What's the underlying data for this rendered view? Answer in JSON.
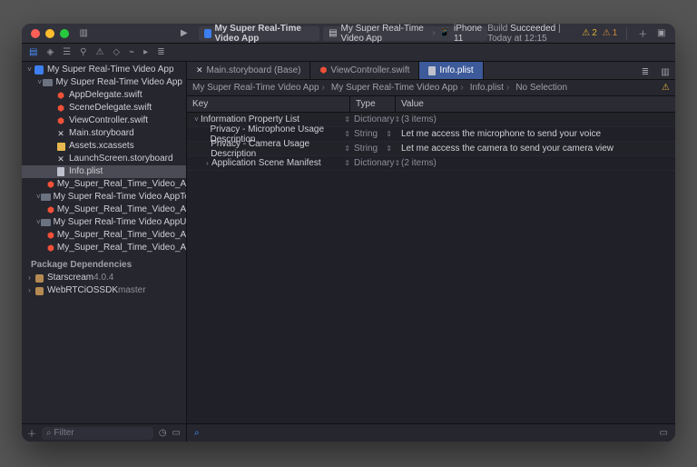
{
  "titlebar": {
    "scheme_app": "My Super Real-Time Video App",
    "scheme_target_prefix": "My Super Real-Time Video App",
    "scheme_device": "iPhone 11",
    "build_status_label": "Build",
    "build_status_result": "Succeeded",
    "build_status_time": "Today at 12:15",
    "warn_count": "2",
    "err_count": "1"
  },
  "tabs": [
    {
      "label": "Main.storyboard (Base)",
      "icon": "storyboard",
      "active": false
    },
    {
      "label": "ViewController.swift",
      "icon": "swift",
      "active": false
    },
    {
      "label": "Info.plist",
      "icon": "plist",
      "active": true
    }
  ],
  "jumpbar": {
    "items": [
      "My Super Real-Time Video App",
      "My Super Real-Time Video App",
      "Info.plist",
      "No Selection"
    ]
  },
  "sidebar": {
    "filter_placeholder": "Filter",
    "root": "My Super Real-Time Video App",
    "groups": [
      {
        "name": "My Super Real-Time Video App",
        "children": [
          {
            "name": "AppDelegate.swift",
            "kind": "swift"
          },
          {
            "name": "SceneDelegate.swift",
            "kind": "swift"
          },
          {
            "name": "ViewController.swift",
            "kind": "swift"
          },
          {
            "name": "Main.storyboard",
            "kind": "sb"
          },
          {
            "name": "Assets.xcassets",
            "kind": "asset"
          },
          {
            "name": "LaunchScreen.storyboard",
            "kind": "sb"
          },
          {
            "name": "Info.plist",
            "kind": "plist",
            "selected": true
          },
          {
            "name": "My_Super_Real_Time_Video_App...",
            "kind": "swift"
          }
        ]
      },
      {
        "name": "My Super Real-Time Video AppTests",
        "children": [
          {
            "name": "My_Super_Real_Time_Video_App...",
            "kind": "swift"
          }
        ]
      },
      {
        "name": "My Super Real-Time Video AppUITe...",
        "children": [
          {
            "name": "My_Super_Real_Time_Video_App...",
            "kind": "swift"
          },
          {
            "name": "My_Super_Real_Time_Video_App...",
            "kind": "swift"
          }
        ]
      }
    ],
    "packages_header": "Package Dependencies",
    "packages": [
      {
        "name": "Starscream",
        "version": "4.0.4"
      },
      {
        "name": "WebRTCiOSSDK",
        "version": "master"
      }
    ]
  },
  "plist": {
    "head_key": "Key",
    "head_type": "Type",
    "head_value": "Value",
    "rows": [
      {
        "key": "Information Property List",
        "type": "Dictionary",
        "value": "(3 items)",
        "disc": "˅",
        "indent": 0
      },
      {
        "key": "Privacy - Microphone Usage Description",
        "type": "String",
        "value": "Let me access the microphone to send your voice",
        "indent": 1
      },
      {
        "key": "Privacy - Camera Usage Description",
        "type": "String",
        "value": "Let me access the camera to send your camera view",
        "indent": 1
      },
      {
        "key": "Application Scene Manifest",
        "type": "Dictionary",
        "value": "(2 items)",
        "disc": "›",
        "indent": 1
      }
    ]
  }
}
